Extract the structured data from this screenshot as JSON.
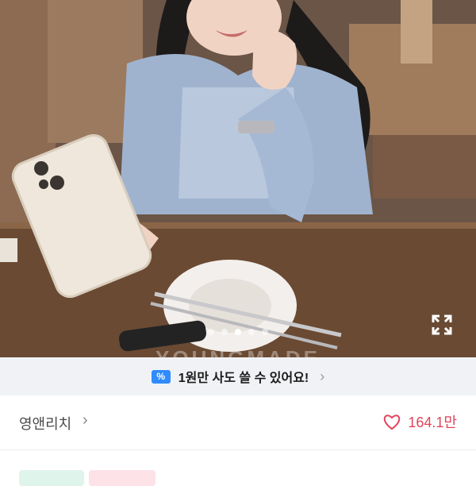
{
  "gallery": {
    "watermark": "YOUNGMADE",
    "active_slide": 3,
    "slide_count": 5,
    "fullscreen_icon": "expand-icon"
  },
  "promo": {
    "icon": "percent-coupon-icon",
    "text": "1원만 사도 쓸 수 있어요!",
    "accent_color": "#2f8bff"
  },
  "store": {
    "name": "영앤리치",
    "like_count": "164.1만",
    "like_color": "#e0455c"
  },
  "tags": [
    {
      "color": "#dff4ea"
    },
    {
      "color": "#fde2e8"
    }
  ]
}
